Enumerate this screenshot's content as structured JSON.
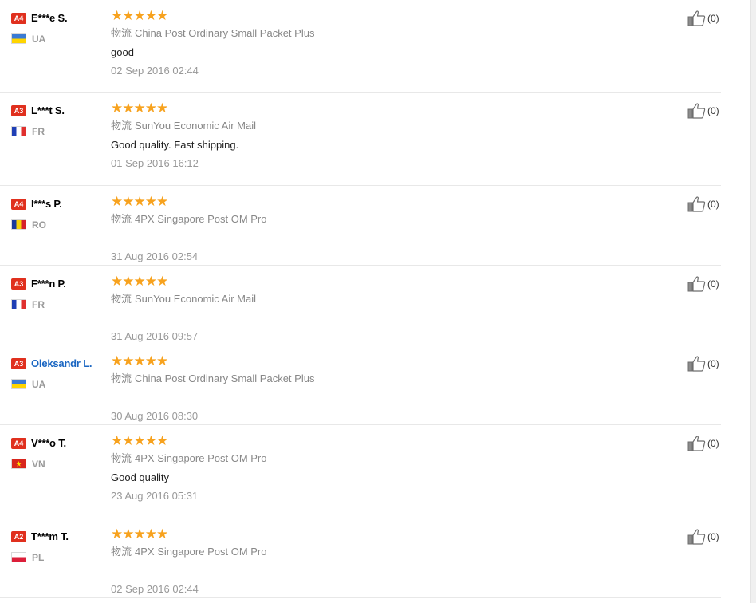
{
  "reviews": [
    {
      "level": "A4",
      "name": "E***e S.",
      "linked": false,
      "country": "UA",
      "stars": 5,
      "logistics_label": "物流",
      "logistics": "China Post Ordinary Small Packet Plus",
      "comment": "good",
      "date": "02 Sep 2016 02:44",
      "helpful": "(0)"
    },
    {
      "level": "A3",
      "name": "L***t S.",
      "linked": false,
      "country": "FR",
      "stars": 5,
      "logistics_label": "物流",
      "logistics": "SunYou Economic Air Mail",
      "comment": "Good quality. Fast shipping.",
      "date": "01 Sep 2016 16:12",
      "helpful": "(0)"
    },
    {
      "level": "A4",
      "name": "I***s P.",
      "linked": false,
      "country": "RO",
      "stars": 5,
      "logistics_label": "物流",
      "logistics": "4PX Singapore Post OM Pro",
      "comment": "",
      "date": "31 Aug 2016 02:54",
      "helpful": "(0)"
    },
    {
      "level": "A3",
      "name": "F***n P.",
      "linked": false,
      "country": "FR",
      "stars": 5,
      "logistics_label": "物流",
      "logistics": "SunYou Economic Air Mail",
      "comment": "",
      "date": "31 Aug 2016 09:57",
      "helpful": "(0)"
    },
    {
      "level": "A3",
      "name": "Oleksandr L.",
      "linked": true,
      "country": "UA",
      "stars": 5,
      "logistics_label": "物流",
      "logistics": "China Post Ordinary Small Packet Plus",
      "comment": "",
      "date": "30 Aug 2016 08:30",
      "helpful": "(0)"
    },
    {
      "level": "A4",
      "name": "V***o T.",
      "linked": false,
      "country": "VN",
      "stars": 5,
      "logistics_label": "物流",
      "logistics": "4PX Singapore Post OM Pro",
      "comment": "Good quality",
      "date": "23 Aug 2016 05:31",
      "helpful": "(0)"
    },
    {
      "level": "A2",
      "name": "T***m T.",
      "linked": false,
      "country": "PL",
      "stars": 5,
      "logistics_label": "物流",
      "logistics": "4PX Singapore Post OM Pro",
      "comment": "",
      "date": "02 Sep 2016 02:44",
      "helpful": "(0)"
    }
  ],
  "icons": {
    "star": "star-icon",
    "thumb": "thumbs-up-icon",
    "flag": "country-flag-icon"
  },
  "colors": {
    "star": "#f7a21e",
    "badge": "#e0301e",
    "link": "#1a66c2",
    "muted": "#999999"
  }
}
